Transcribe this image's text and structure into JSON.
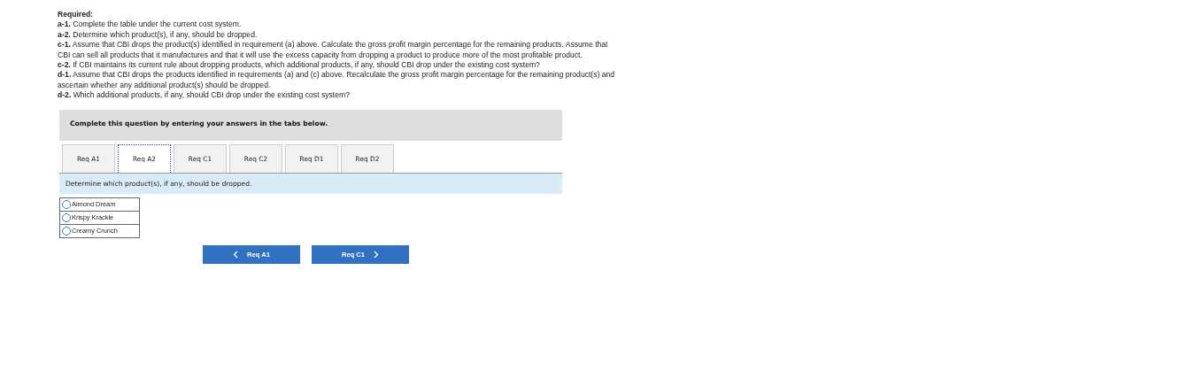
{
  "required": {
    "heading": "Required:",
    "items": [
      "**a-1.** Complete the table under the current cost system.",
      "**a-2.** Determine which product(s), if any, should be dropped.",
      "**c-1.** Assume that CBI drops the product(s) identified in requirement (a) above. Calculate the gross profit margin percentage for the remaining products. Assume that CBI can sell all products that it manufactures and that it will use the excess capacity from dropping a product to produce more of the most profitable product.",
      "**c-2.** If CBI maintains its current rule about dropping products, which additional products, if any, should CBI drop under the existing cost system?",
      "**d-1.** Assume that CBI drops the products identified in requirements (a) and (c) above. Recalculate the gross profit margin percentage for the remaining product(s) and ascertain whether any additional product(s) should be dropped.",
      "**d-2.** Which additional products, if any, should CBI drop under the existing cost system?"
    ]
  },
  "instruction": "Complete this question by entering your answers in the tabs below.",
  "tabs": [
    {
      "label": "Req A1",
      "selected": false
    },
    {
      "label": "Req A2",
      "selected": true
    },
    {
      "label": "Req C1",
      "selected": false
    },
    {
      "label": "Req C2",
      "selected": false
    },
    {
      "label": "Req D1",
      "selected": false
    },
    {
      "label": "Req D2",
      "selected": false
    }
  ],
  "question": "Determine which product(s), if any, should be dropped.",
  "options": [
    {
      "label": "Almond Dream",
      "selected": false
    },
    {
      "label": "Krispy Krackle",
      "selected": false
    },
    {
      "label": "Creamy Crunch",
      "selected": false
    }
  ],
  "nav": {
    "prev": "Req A1",
    "next": "Req C1"
  }
}
